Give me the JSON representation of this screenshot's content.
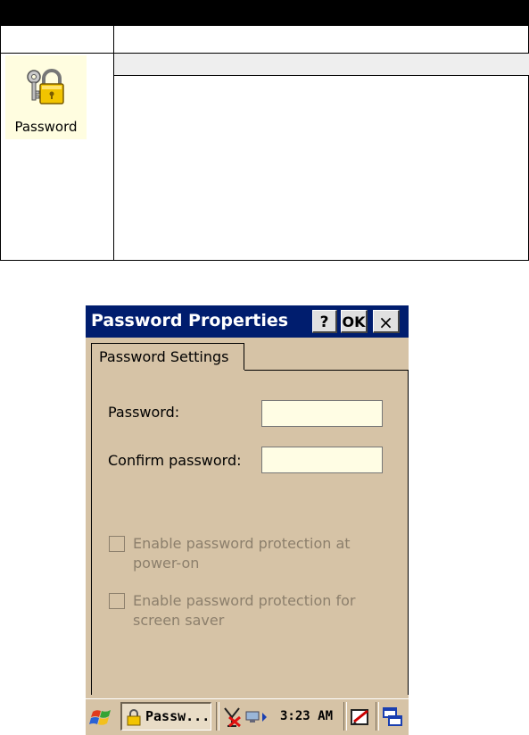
{
  "document": {
    "icon_caption": "Password"
  },
  "dialog": {
    "title": "Password Properties",
    "buttons": {
      "help": "?",
      "ok": "OK",
      "close": "×"
    },
    "tab_label": "Password Settings",
    "password_label": "Password:",
    "password_value": "",
    "confirm_label": "Confirm password:",
    "confirm_value": "",
    "checkbox_poweron": "Enable password protection at power-on",
    "checkbox_poweron_checked": false,
    "checkbox_screensaver": "Enable password protection for screen saver",
    "checkbox_screensaver_checked": false
  },
  "taskbar": {
    "task_label": "Passw...",
    "clock": "3:23 AM",
    "icons": [
      "windows-start-icon",
      "lock-icon",
      "network-disconnected-icon",
      "connection-icon",
      "input-panel-icon",
      "desktop-icon"
    ]
  },
  "colors": {
    "title_bar": "#001d6e",
    "dialog_bg": "#d6c3a6",
    "input_bg": "#fffde4",
    "disabled_text": "#8c7f6c",
    "icon_bg": "#fffde0"
  }
}
